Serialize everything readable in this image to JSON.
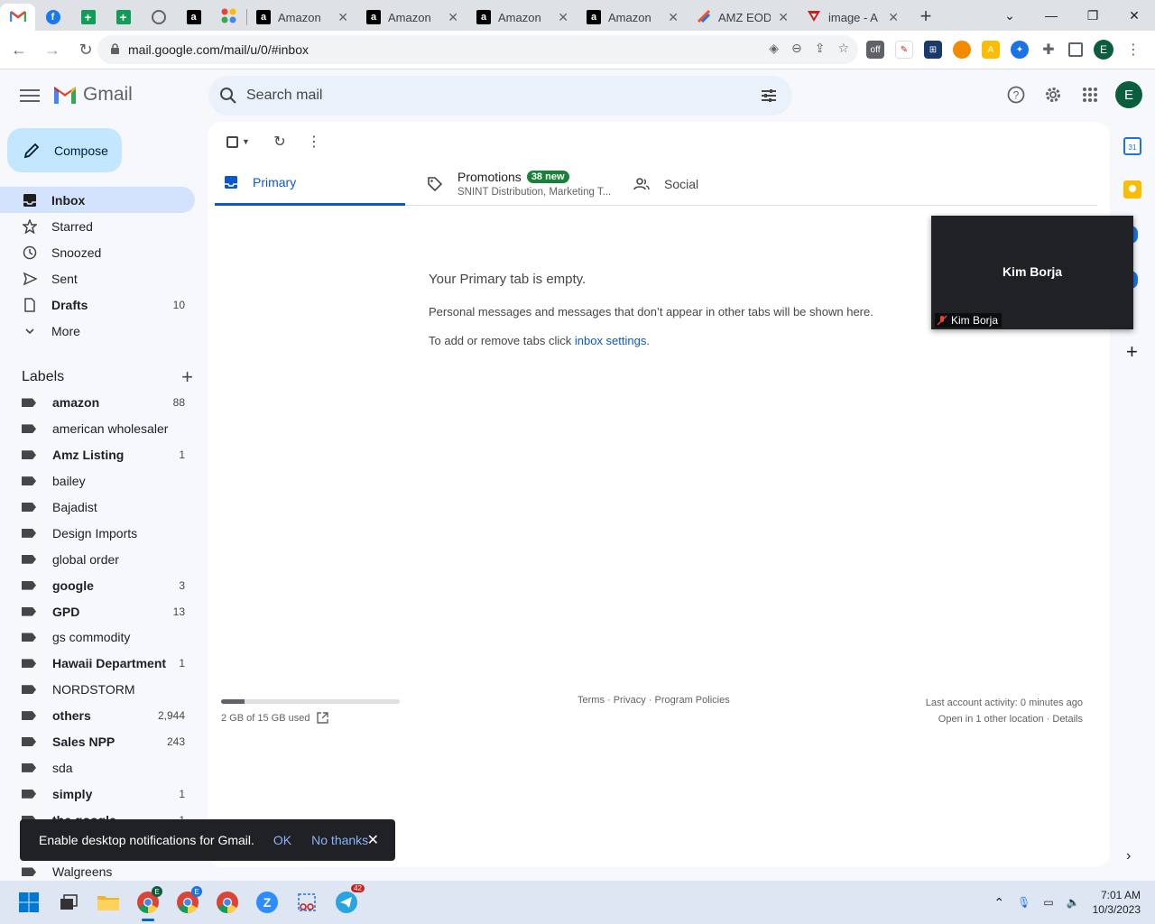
{
  "browser": {
    "tabs": [
      {
        "title": "",
        "icon": "gmail-icon"
      },
      {
        "title": "",
        "icon": "facebook-icon"
      },
      {
        "title": "",
        "icon": "sheets-icon"
      },
      {
        "title": "",
        "icon": "sheets-icon"
      },
      {
        "title": "",
        "icon": "globe-icon"
      },
      {
        "title": "",
        "icon": "amazon-icon"
      },
      {
        "title": "",
        "icon": "apps-icon"
      },
      {
        "title": "Amazon",
        "icon": "amazon-icon"
      },
      {
        "title": "Amazon",
        "icon": "amazon-icon"
      },
      {
        "title": "Amazon",
        "icon": "amazon-icon"
      },
      {
        "title": "Amazon",
        "icon": "amazon-icon"
      },
      {
        "title": "AMZ EOD",
        "icon": "amz-eod-icon"
      },
      {
        "title": "image - A",
        "icon": "image-icon"
      }
    ],
    "url": "mail.google.com/mail/u/0/#inbox",
    "profile_initial": "E"
  },
  "gmail": {
    "wordmark": "Gmail",
    "search_placeholder": "Search mail",
    "avatar_initial": "E",
    "compose_label": "Compose",
    "nav": [
      {
        "label": "Inbox",
        "count": "",
        "icon": "inbox-icon",
        "active": true,
        "bold": true
      },
      {
        "label": "Starred",
        "count": "",
        "icon": "star-icon",
        "active": false,
        "bold": false
      },
      {
        "label": "Snoozed",
        "count": "",
        "icon": "clock-icon",
        "active": false,
        "bold": false
      },
      {
        "label": "Sent",
        "count": "",
        "icon": "send-icon",
        "active": false,
        "bold": false
      },
      {
        "label": "Drafts",
        "count": "10",
        "icon": "draft-icon",
        "active": false,
        "bold": true
      },
      {
        "label": "More",
        "count": "",
        "icon": "chevron-down-icon",
        "active": false,
        "bold": false
      }
    ],
    "labels_title": "Labels",
    "labels": [
      {
        "name": "amazon",
        "count": "88",
        "bold": true
      },
      {
        "name": "american wholesaler",
        "count": "",
        "bold": false
      },
      {
        "name": "Amz Listing",
        "count": "1",
        "bold": true
      },
      {
        "name": "bailey",
        "count": "",
        "bold": false
      },
      {
        "name": "Bajadist",
        "count": "",
        "bold": false
      },
      {
        "name": "Design Imports",
        "count": "",
        "bold": false
      },
      {
        "name": "global order",
        "count": "",
        "bold": false
      },
      {
        "name": "google",
        "count": "3",
        "bold": true
      },
      {
        "name": "GPD",
        "count": "13",
        "bold": true
      },
      {
        "name": "gs commodity",
        "count": "",
        "bold": false
      },
      {
        "name": "Hawaii Department",
        "count": "1",
        "bold": true
      },
      {
        "name": "NORDSTORM",
        "count": "",
        "bold": false
      },
      {
        "name": "others",
        "count": "2,944",
        "bold": true
      },
      {
        "name": "Sales NPP",
        "count": "243",
        "bold": true
      },
      {
        "name": "sda",
        "count": "",
        "bold": false
      },
      {
        "name": "simply",
        "count": "1",
        "bold": true
      },
      {
        "name": "the google",
        "count": "1",
        "bold": true
      },
      {
        "name": "",
        "count": "",
        "bold": false
      },
      {
        "name": "Walgreens",
        "count": "",
        "bold": false
      }
    ],
    "tabs": {
      "primary": "Primary",
      "promotions": "Promotions",
      "promotions_badge": "38 new",
      "promotions_sub": "SNINT Distribution, Marketing T...",
      "social": "Social"
    },
    "empty": {
      "title": "Your Primary tab is empty.",
      "line1": "Personal messages and messages that don’t appear in other tabs will be shown here.",
      "line2_prefix": "To add or remove tabs click ",
      "line2_link": "inbox settings",
      "line2_suffix": "."
    },
    "footer": {
      "storage_text": "2 GB of 15 GB used",
      "storage_fraction": 0.133,
      "policies": "Terms · Privacy · Program Policies",
      "activity": "Last account activity: 0 minutes ago",
      "location": "Open in 1 other location · Details"
    }
  },
  "video_pip": {
    "name": "Kim Borja",
    "label": "Kim Borja"
  },
  "snackbar": {
    "message": "Enable desktop notifications for Gmail.",
    "ok": "OK",
    "no_thanks": "No thanks"
  },
  "taskbar": {
    "time": "7:01 AM",
    "date": "10/3/2023",
    "telegram_badge": "42"
  },
  "colors": {
    "accent": "#0b57d0",
    "compose_bg": "#c2e7ff",
    "active_nav": "#d3e3fd",
    "badge_green": "#188038",
    "avatar": "#0b5e3d"
  }
}
